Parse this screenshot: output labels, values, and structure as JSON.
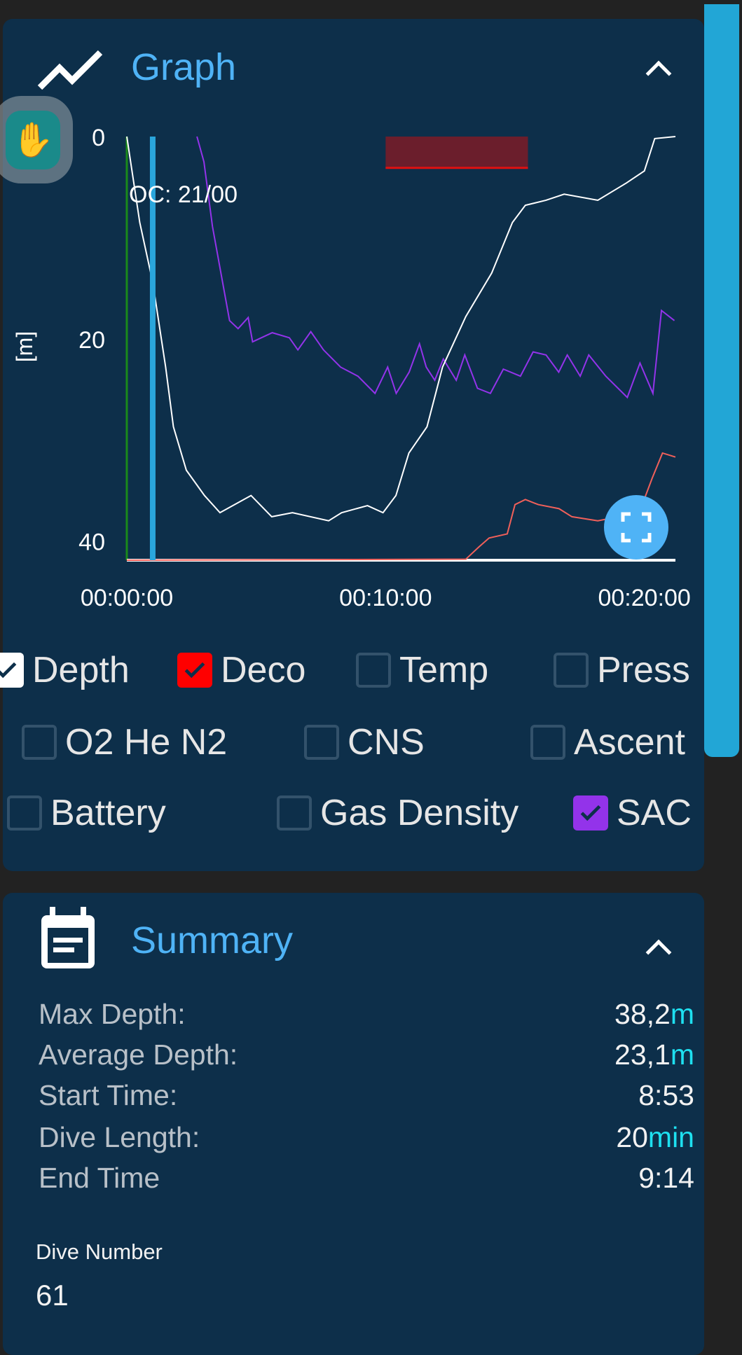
{
  "graph": {
    "title": "Graph",
    "oc_label": "OC: 21/00",
    "y_unit": "[m]"
  },
  "checkboxes": [
    {
      "label": "Depth",
      "checked": true,
      "color": "#ffffff"
    },
    {
      "label": "Deco",
      "checked": true,
      "color": "#ff0000"
    },
    {
      "label": "Temp",
      "checked": false
    },
    {
      "label": "Press",
      "checked": false
    },
    {
      "label": "O2 He N2",
      "checked": false
    },
    {
      "label": "CNS",
      "checked": false
    },
    {
      "label": "Ascent",
      "checked": false
    },
    {
      "label": "Battery",
      "checked": false
    },
    {
      "label": "Gas Density",
      "checked": false
    },
    {
      "label": "SAC",
      "checked": true,
      "color": "#9333ea"
    }
  ],
  "summary": {
    "title": "Summary",
    "rows": [
      {
        "label": "Max Depth:",
        "value": "38,2",
        "unit": "m"
      },
      {
        "label": "Average Depth:",
        "value": "23,1",
        "unit": "m"
      },
      {
        "label": "Start Time:",
        "value": "8:53",
        "unit": ""
      },
      {
        "label": "Dive Length:",
        "value": "20",
        "unit": "min"
      },
      {
        "label": "End Time",
        "value": "9:14",
        "unit": ""
      }
    ],
    "dive_number_label": "Dive Number",
    "dive_number": "61"
  },
  "chart_data": {
    "type": "line",
    "ylabel": "[m]",
    "y_inverted": true,
    "ylim": [
      0,
      41.9
    ],
    "xlim_minutes": [
      0,
      21.2
    ],
    "yticks": [
      "0",
      "20",
      "40"
    ],
    "xticks": [
      {
        "label": "00:00:00",
        "minutes": 0
      },
      {
        "label": "00:10:00",
        "minutes": 10
      },
      {
        "label": "00:20:00",
        "minutes": 20
      }
    ],
    "series": [
      {
        "name": "Depth",
        "color": "#ffffff",
        "points": [
          [
            0,
            0
          ],
          [
            0.5,
            8.5
          ],
          [
            1,
            14.4
          ],
          [
            1.5,
            22.8
          ],
          [
            1.8,
            28.7
          ],
          [
            2.3,
            33
          ],
          [
            3,
            35.5
          ],
          [
            3.6,
            37.2
          ],
          [
            4.8,
            35.5
          ],
          [
            5.6,
            37.6
          ],
          [
            6.4,
            37.2
          ],
          [
            7.8,
            38
          ],
          [
            8.3,
            37.2
          ],
          [
            9.3,
            36.5
          ],
          [
            9.9,
            37.2
          ],
          [
            10.4,
            35.5
          ],
          [
            10.9,
            31.3
          ],
          [
            11.6,
            28.7
          ],
          [
            12.2,
            22.8
          ],
          [
            13.1,
            17.8
          ],
          [
            14.1,
            13.5
          ],
          [
            14.9,
            8.5
          ],
          [
            15.4,
            6.8
          ],
          [
            16.2,
            6.3
          ],
          [
            16.9,
            5.7
          ],
          [
            18.2,
            6.3
          ],
          [
            19.3,
            4.6
          ],
          [
            20,
            3.4
          ],
          [
            20.4,
            0.2
          ],
          [
            21.2,
            0
          ]
        ]
      },
      {
        "name": "SAC",
        "color": "#9333ea",
        "points": [
          [
            2.71,
            0
          ],
          [
            2.98,
            2.5
          ],
          [
            3.31,
            8.9
          ],
          [
            3.97,
            18.2
          ],
          [
            4.3,
            19
          ],
          [
            4.69,
            17.9
          ],
          [
            4.86,
            20.3
          ],
          [
            5.62,
            19.4
          ],
          [
            6.28,
            19.9
          ],
          [
            6.61,
            21.1
          ],
          [
            7.11,
            19.3
          ],
          [
            7.6,
            21.1
          ],
          [
            8.26,
            22.8
          ],
          [
            8.93,
            23.7
          ],
          [
            9.59,
            25.4
          ],
          [
            10.08,
            22.8
          ],
          [
            10.41,
            25.4
          ],
          [
            10.91,
            23.3
          ],
          [
            11.31,
            20.5
          ],
          [
            11.57,
            22.8
          ],
          [
            11.9,
            24.1
          ],
          [
            12.23,
            22
          ],
          [
            12.73,
            24.1
          ],
          [
            13.06,
            21.6
          ],
          [
            13.55,
            24.9
          ],
          [
            14.05,
            25.4
          ],
          [
            14.55,
            23
          ],
          [
            15.21,
            23.7
          ],
          [
            15.7,
            21.3
          ],
          [
            16.2,
            21.6
          ],
          [
            16.69,
            23.3
          ],
          [
            17.02,
            21.6
          ],
          [
            17.52,
            23.7
          ],
          [
            17.85,
            21.6
          ],
          [
            18.51,
            23.7
          ],
          [
            19.34,
            25.8
          ],
          [
            19.83,
            22.4
          ],
          [
            20.33,
            25.4
          ],
          [
            20.66,
            17.2
          ],
          [
            21.16,
            18.2
          ]
        ]
      },
      {
        "name": "Deco",
        "color": "#f0605a",
        "points": [
          [
            0,
            41.9
          ],
          [
            13.1,
            41.8
          ],
          [
            13.6,
            40.6
          ],
          [
            14,
            39.7
          ],
          [
            14.7,
            39.3
          ],
          [
            15,
            36.4
          ],
          [
            15.4,
            35.9
          ],
          [
            15.9,
            36.4
          ],
          [
            16.7,
            36.8
          ],
          [
            17.2,
            37.6
          ],
          [
            18.2,
            38
          ],
          [
            19.8,
            37.2
          ],
          [
            20.3,
            33.8
          ],
          [
            20.7,
            31.3
          ],
          [
            21.2,
            31.7
          ]
        ]
      }
    ],
    "markers": {
      "gas_switch_minutes": 0,
      "current_time_minutes": 1.0,
      "warning_band_minutes": [
        10,
        15.5
      ],
      "warning_band_depth": [
        0,
        3.1
      ],
      "warning_color": "#6b1e2c"
    }
  }
}
